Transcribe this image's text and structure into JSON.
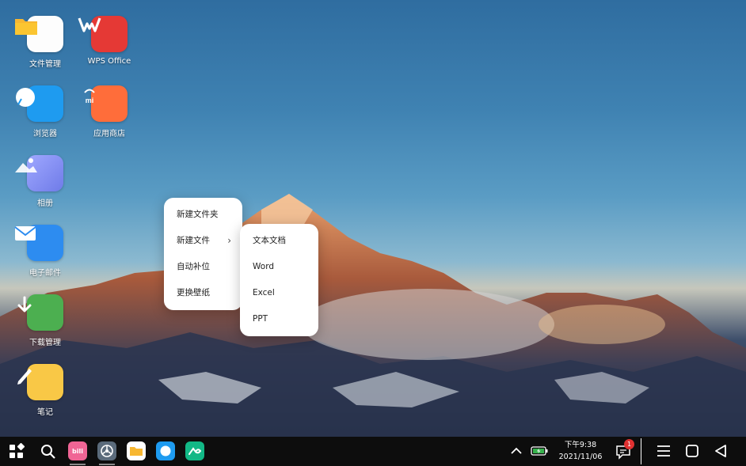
{
  "desktop": {
    "icons": [
      {
        "label": "文件管理",
        "icon": "folder-icon",
        "color": "#f7b731"
      },
      {
        "label": "WPS Office",
        "icon": "wps-icon",
        "color": "#e53935"
      },
      {
        "label": "浏览器",
        "icon": "browser-icon",
        "color": "#1e9bf0"
      },
      {
        "label": "应用商店",
        "icon": "mi-store-icon",
        "color": "#ff6d3a"
      },
      {
        "label": "相册",
        "icon": "gallery-icon",
        "color": "#7f8cf0"
      },
      {
        "label": "电子邮件",
        "icon": "mail-icon",
        "color": "#2d8cf0"
      },
      {
        "label": "下载管理",
        "icon": "download-icon",
        "color": "#4caf50"
      },
      {
        "label": "笔记",
        "icon": "notes-icon",
        "color": "#f9c846"
      }
    ]
  },
  "context_menu": {
    "items": [
      "新建文件夹",
      "新建文件",
      "自动补位",
      "更换壁纸"
    ],
    "submenu_arrow": "›"
  },
  "submenu": {
    "items": [
      "文本文档",
      "Word",
      "Excel",
      "PPT"
    ]
  },
  "taskbar": {
    "start_icon": "start-grid-icon",
    "search_icon": "search-icon",
    "apps": [
      {
        "name": "bilibili",
        "color": "#f06595",
        "text": "bili"
      },
      {
        "name": "settings",
        "color": "#5b6b7b"
      },
      {
        "name": "files",
        "color": "#f7b731"
      },
      {
        "name": "browser",
        "color": "#1e9bf0"
      },
      {
        "name": "app",
        "color": "#12b886"
      }
    ],
    "time": "下午9:38",
    "date": "2021/11/06",
    "notification_count": "1"
  }
}
